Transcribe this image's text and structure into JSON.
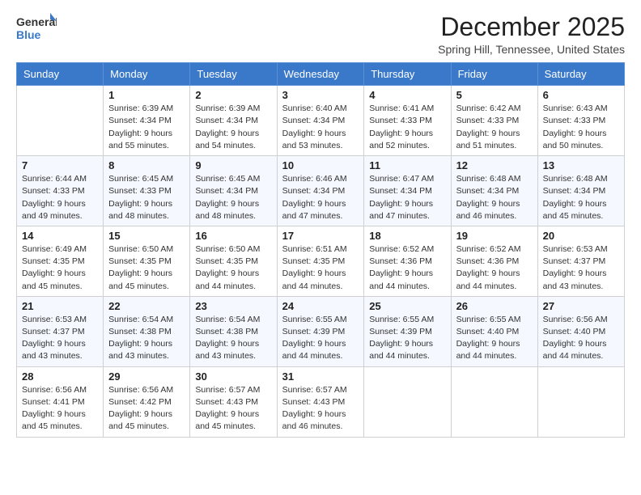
{
  "logo": {
    "text_general": "General",
    "text_blue": "Blue"
  },
  "title": "December 2025",
  "subtitle": "Spring Hill, Tennessee, United States",
  "days_of_week": [
    "Sunday",
    "Monday",
    "Tuesday",
    "Wednesday",
    "Thursday",
    "Friday",
    "Saturday"
  ],
  "weeks": [
    [
      {
        "day": "",
        "sunrise": "",
        "sunset": "",
        "daylight": ""
      },
      {
        "day": "1",
        "sunrise": "Sunrise: 6:39 AM",
        "sunset": "Sunset: 4:34 PM",
        "daylight": "Daylight: 9 hours and 55 minutes."
      },
      {
        "day": "2",
        "sunrise": "Sunrise: 6:39 AM",
        "sunset": "Sunset: 4:34 PM",
        "daylight": "Daylight: 9 hours and 54 minutes."
      },
      {
        "day": "3",
        "sunrise": "Sunrise: 6:40 AM",
        "sunset": "Sunset: 4:34 PM",
        "daylight": "Daylight: 9 hours and 53 minutes."
      },
      {
        "day": "4",
        "sunrise": "Sunrise: 6:41 AM",
        "sunset": "Sunset: 4:33 PM",
        "daylight": "Daylight: 9 hours and 52 minutes."
      },
      {
        "day": "5",
        "sunrise": "Sunrise: 6:42 AM",
        "sunset": "Sunset: 4:33 PM",
        "daylight": "Daylight: 9 hours and 51 minutes."
      },
      {
        "day": "6",
        "sunrise": "Sunrise: 6:43 AM",
        "sunset": "Sunset: 4:33 PM",
        "daylight": "Daylight: 9 hours and 50 minutes."
      }
    ],
    [
      {
        "day": "7",
        "sunrise": "Sunrise: 6:44 AM",
        "sunset": "Sunset: 4:33 PM",
        "daylight": "Daylight: 9 hours and 49 minutes."
      },
      {
        "day": "8",
        "sunrise": "Sunrise: 6:45 AM",
        "sunset": "Sunset: 4:33 PM",
        "daylight": "Daylight: 9 hours and 48 minutes."
      },
      {
        "day": "9",
        "sunrise": "Sunrise: 6:45 AM",
        "sunset": "Sunset: 4:34 PM",
        "daylight": "Daylight: 9 hours and 48 minutes."
      },
      {
        "day": "10",
        "sunrise": "Sunrise: 6:46 AM",
        "sunset": "Sunset: 4:34 PM",
        "daylight": "Daylight: 9 hours and 47 minutes."
      },
      {
        "day": "11",
        "sunrise": "Sunrise: 6:47 AM",
        "sunset": "Sunset: 4:34 PM",
        "daylight": "Daylight: 9 hours and 47 minutes."
      },
      {
        "day": "12",
        "sunrise": "Sunrise: 6:48 AM",
        "sunset": "Sunset: 4:34 PM",
        "daylight": "Daylight: 9 hours and 46 minutes."
      },
      {
        "day": "13",
        "sunrise": "Sunrise: 6:48 AM",
        "sunset": "Sunset: 4:34 PM",
        "daylight": "Daylight: 9 hours and 45 minutes."
      }
    ],
    [
      {
        "day": "14",
        "sunrise": "Sunrise: 6:49 AM",
        "sunset": "Sunset: 4:35 PM",
        "daylight": "Daylight: 9 hours and 45 minutes."
      },
      {
        "day": "15",
        "sunrise": "Sunrise: 6:50 AM",
        "sunset": "Sunset: 4:35 PM",
        "daylight": "Daylight: 9 hours and 45 minutes."
      },
      {
        "day": "16",
        "sunrise": "Sunrise: 6:50 AM",
        "sunset": "Sunset: 4:35 PM",
        "daylight": "Daylight: 9 hours and 44 minutes."
      },
      {
        "day": "17",
        "sunrise": "Sunrise: 6:51 AM",
        "sunset": "Sunset: 4:35 PM",
        "daylight": "Daylight: 9 hours and 44 minutes."
      },
      {
        "day": "18",
        "sunrise": "Sunrise: 6:52 AM",
        "sunset": "Sunset: 4:36 PM",
        "daylight": "Daylight: 9 hours and 44 minutes."
      },
      {
        "day": "19",
        "sunrise": "Sunrise: 6:52 AM",
        "sunset": "Sunset: 4:36 PM",
        "daylight": "Daylight: 9 hours and 44 minutes."
      },
      {
        "day": "20",
        "sunrise": "Sunrise: 6:53 AM",
        "sunset": "Sunset: 4:37 PM",
        "daylight": "Daylight: 9 hours and 43 minutes."
      }
    ],
    [
      {
        "day": "21",
        "sunrise": "Sunrise: 6:53 AM",
        "sunset": "Sunset: 4:37 PM",
        "daylight": "Daylight: 9 hours and 43 minutes."
      },
      {
        "day": "22",
        "sunrise": "Sunrise: 6:54 AM",
        "sunset": "Sunset: 4:38 PM",
        "daylight": "Daylight: 9 hours and 43 minutes."
      },
      {
        "day": "23",
        "sunrise": "Sunrise: 6:54 AM",
        "sunset": "Sunset: 4:38 PM",
        "daylight": "Daylight: 9 hours and 43 minutes."
      },
      {
        "day": "24",
        "sunrise": "Sunrise: 6:55 AM",
        "sunset": "Sunset: 4:39 PM",
        "daylight": "Daylight: 9 hours and 44 minutes."
      },
      {
        "day": "25",
        "sunrise": "Sunrise: 6:55 AM",
        "sunset": "Sunset: 4:39 PM",
        "daylight": "Daylight: 9 hours and 44 minutes."
      },
      {
        "day": "26",
        "sunrise": "Sunrise: 6:55 AM",
        "sunset": "Sunset: 4:40 PM",
        "daylight": "Daylight: 9 hours and 44 minutes."
      },
      {
        "day": "27",
        "sunrise": "Sunrise: 6:56 AM",
        "sunset": "Sunset: 4:40 PM",
        "daylight": "Daylight: 9 hours and 44 minutes."
      }
    ],
    [
      {
        "day": "28",
        "sunrise": "Sunrise: 6:56 AM",
        "sunset": "Sunset: 4:41 PM",
        "daylight": "Daylight: 9 hours and 45 minutes."
      },
      {
        "day": "29",
        "sunrise": "Sunrise: 6:56 AM",
        "sunset": "Sunset: 4:42 PM",
        "daylight": "Daylight: 9 hours and 45 minutes."
      },
      {
        "day": "30",
        "sunrise": "Sunrise: 6:57 AM",
        "sunset": "Sunset: 4:43 PM",
        "daylight": "Daylight: 9 hours and 45 minutes."
      },
      {
        "day": "31",
        "sunrise": "Sunrise: 6:57 AM",
        "sunset": "Sunset: 4:43 PM",
        "daylight": "Daylight: 9 hours and 46 minutes."
      },
      {
        "day": "",
        "sunrise": "",
        "sunset": "",
        "daylight": ""
      },
      {
        "day": "",
        "sunrise": "",
        "sunset": "",
        "daylight": ""
      },
      {
        "day": "",
        "sunrise": "",
        "sunset": "",
        "daylight": ""
      }
    ]
  ]
}
